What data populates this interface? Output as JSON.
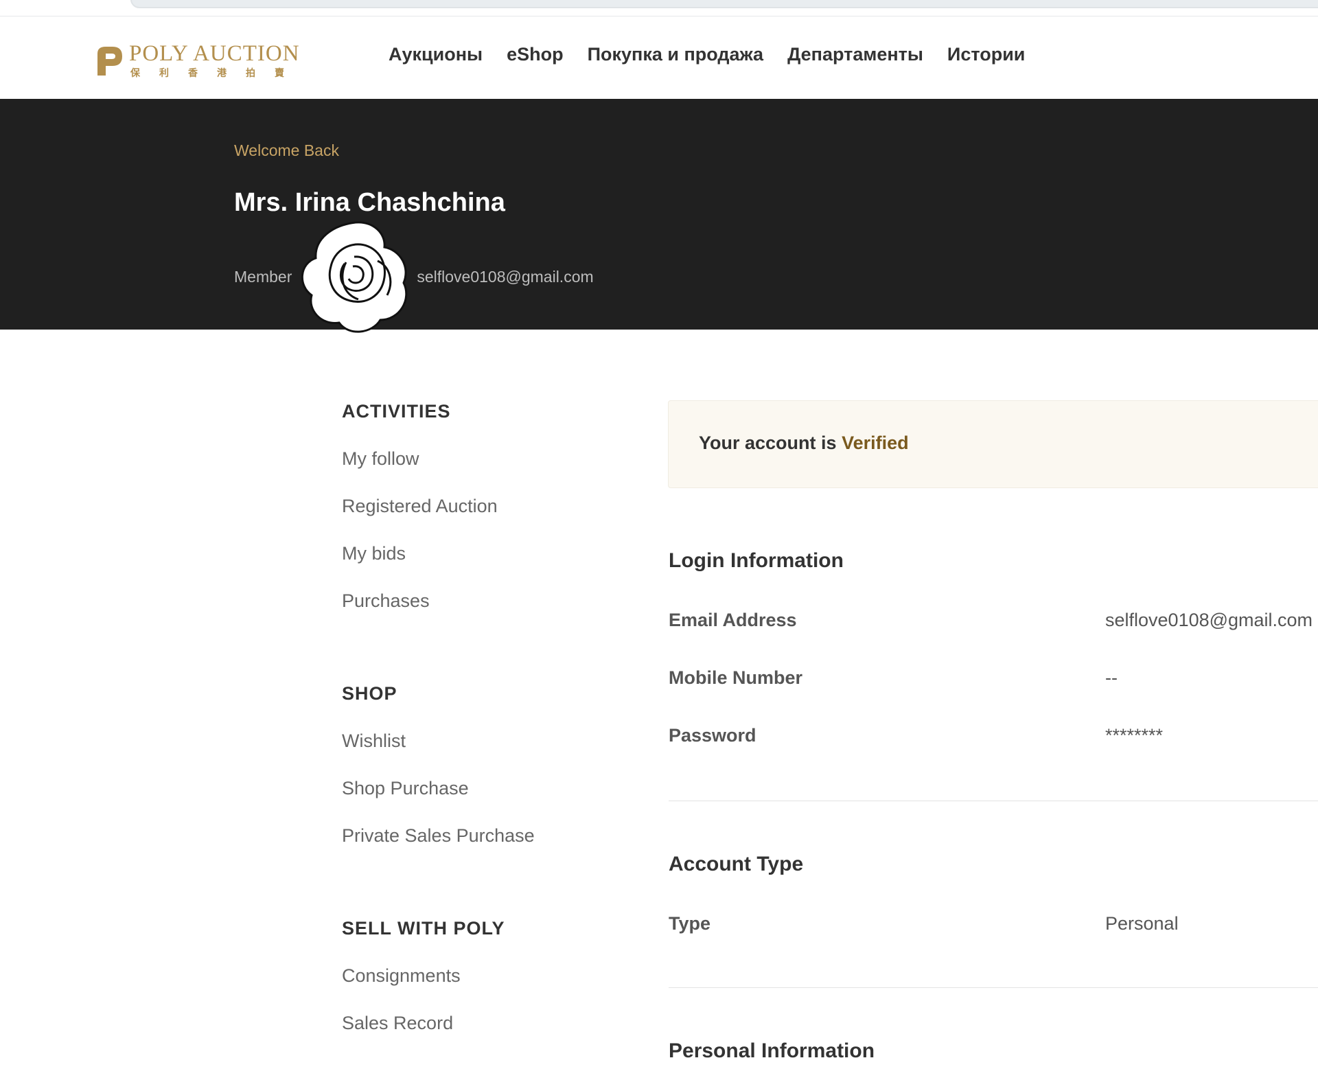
{
  "nav": {
    "logo": {
      "name": "POLY AUCTION",
      "cn": "保利香港拍賣"
    },
    "menu": [
      "Аукционы",
      "eShop",
      "Покупка и продажа",
      "Департаменты",
      "Истории"
    ]
  },
  "hero": {
    "welcome": "Welcome Back",
    "name": "Mrs. Irina Chashchina",
    "member_label": "Member",
    "separator": "|",
    "email": "selflove0108@gmail.com"
  },
  "sidebar": {
    "activities": {
      "title": "ACTIVITIES",
      "items": [
        "My follow",
        "Registered Auction",
        "My bids",
        "Purchases"
      ]
    },
    "shop": {
      "title": "SHOP",
      "items": [
        "Wishlist",
        "Shop Purchase",
        "Private Sales Purchase"
      ]
    },
    "sell": {
      "title": "SELL WITH POLY",
      "items": [
        "Consignments",
        "Sales Record"
      ]
    }
  },
  "account_status": {
    "prefix": "Your account is",
    "status": "Verified"
  },
  "login_info": {
    "title": "Login Information",
    "email_label": "Email Address",
    "email_value": "selflove0108@gmail.com",
    "mobile_label": "Mobile Number",
    "mobile_value": "--",
    "password_label": "Password",
    "password_value": "********"
  },
  "account_type": {
    "title": "Account Type",
    "type_label": "Type",
    "type_value": "Personal"
  },
  "personal_info": {
    "title": "Personal Information"
  },
  "colors": {
    "gold": "#b38f4d",
    "hero_bg": "#202020",
    "verified": "#7a5a1e"
  },
  "icons": {
    "logo": "poly-p-logo-icon",
    "sticker": "rose-icon"
  }
}
